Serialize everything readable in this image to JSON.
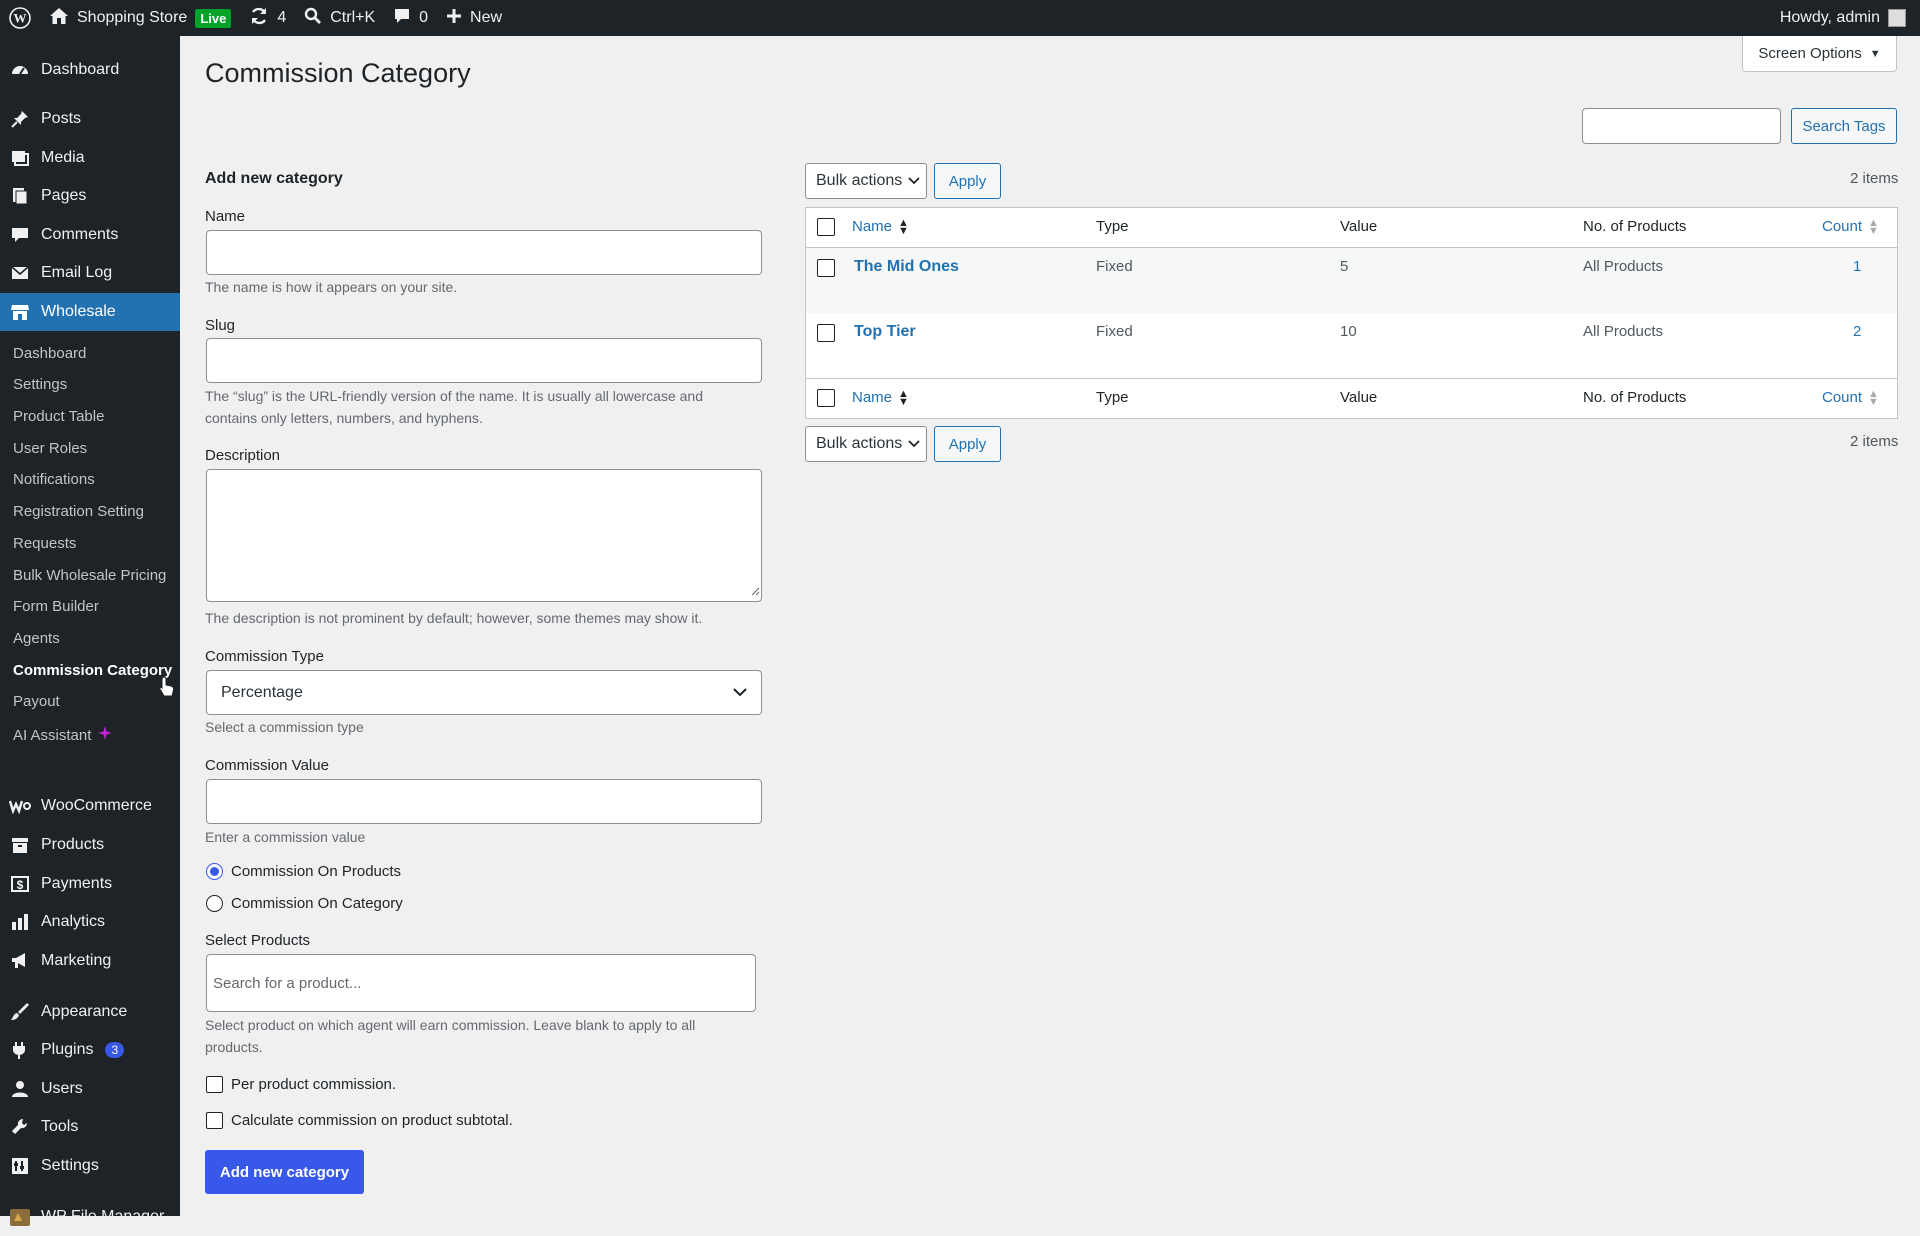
{
  "adminbar": {
    "site_name": "Shopping Store",
    "live_badge": "Live",
    "updates_count": "4",
    "search_shortcut": "Ctrl+K",
    "comments_count": "0",
    "new_label": "New",
    "greeting": "Howdy, admin"
  },
  "sidebar": {
    "top_items": [
      {
        "label": "Dashboard",
        "icon": "dashboard-icon"
      },
      {
        "label": "Posts",
        "icon": "pin-icon"
      },
      {
        "label": "Media",
        "icon": "media-icon"
      },
      {
        "label": "Pages",
        "icon": "pages-icon"
      },
      {
        "label": "Comments",
        "icon": "comment-icon"
      },
      {
        "label": "Email Log",
        "icon": "email-icon"
      },
      {
        "label": "Wholesale",
        "icon": "store-icon"
      }
    ],
    "sub_items": [
      "Dashboard",
      "Settings",
      "Product Table",
      "User Roles",
      "Notifications",
      "Registration Setting",
      "Requests",
      "Bulk Wholesale Pricing",
      "Form Builder",
      "Agents",
      "Commission Category",
      "Payout",
      "AI Assistant"
    ],
    "bottom_items": [
      {
        "label": "WooCommerce",
        "icon": "woocommerce-icon"
      },
      {
        "label": "Products",
        "icon": "products-icon"
      },
      {
        "label": "Payments",
        "icon": "payments-icon"
      },
      {
        "label": "Analytics",
        "icon": "analytics-icon"
      },
      {
        "label": "Marketing",
        "icon": "megaphone-icon"
      },
      {
        "label": "Appearance",
        "icon": "brush-icon"
      },
      {
        "label": "Plugins",
        "icon": "plugin-icon",
        "badge": "3"
      },
      {
        "label": "Users",
        "icon": "user-icon"
      },
      {
        "label": "Tools",
        "icon": "wrench-icon"
      },
      {
        "label": "Settings",
        "icon": "settings-icon"
      },
      {
        "label": "WP File Manager",
        "icon": "file-manager-icon"
      }
    ]
  },
  "page": {
    "title": "Commission Category",
    "screen_options": "Screen Options",
    "search_button": "Search Tags"
  },
  "form": {
    "heading": "Add new category",
    "name_label": "Name",
    "name_help": "The name is how it appears on your site.",
    "slug_label": "Slug",
    "slug_help_1": "The “slug” is the URL-friendly version of the name. It is usually all lowercase and",
    "slug_help_2": "contains only letters, numbers, and hyphens.",
    "description_label": "Description",
    "description_help": "The description is not prominent by default; however, some themes may show it.",
    "commission_type_label": "Commission Type",
    "commission_type_value": "Percentage",
    "commission_type_help": "Select a commission type",
    "commission_value_label": "Commission Value",
    "commission_value_help": "Enter a commission value",
    "radio_products": "Commission On Products",
    "radio_category": "Commission On Category",
    "select_products_label": "Select Products",
    "select_products_placeholder": "Search for a product...",
    "select_products_help_1": "Select product on which agent will earn commission. Leave blank to apply to all",
    "select_products_help_2": "products.",
    "per_product_label": "Per product commission.",
    "subtotal_label": "Calculate commission on product subtotal.",
    "submit_label": "Add new category"
  },
  "table": {
    "bulk_actions": "Bulk actions",
    "apply": "Apply",
    "items_count": "2 items",
    "columns": [
      "Name",
      "Type",
      "Value",
      "No. of Products",
      "Count"
    ],
    "rows": [
      {
        "name": "The Mid Ones",
        "type": "Fixed",
        "value": "5",
        "products": "All Products",
        "count": "1"
      },
      {
        "name": "Top Tier",
        "type": "Fixed",
        "value": "10",
        "products": "All Products",
        "count": "2"
      }
    ]
  }
}
